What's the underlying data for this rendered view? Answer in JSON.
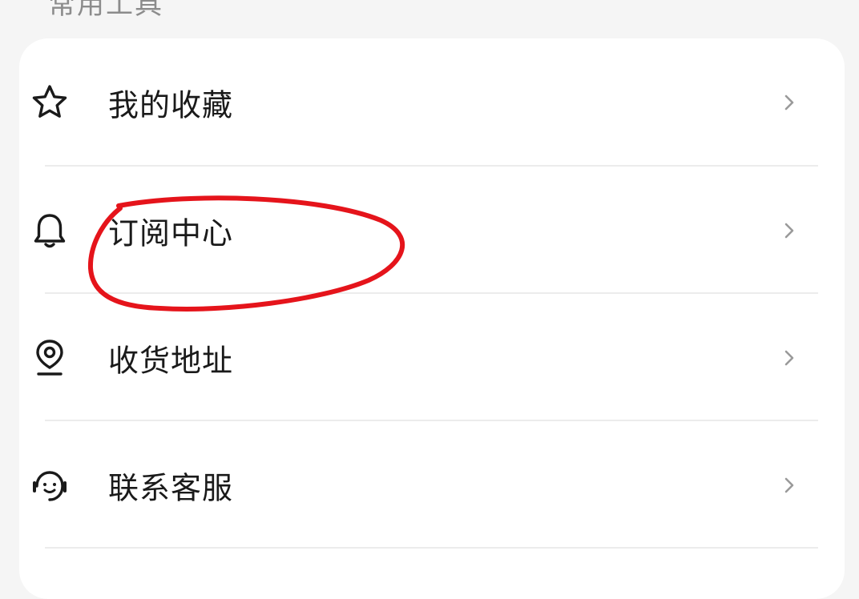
{
  "section": {
    "title": "常用工具"
  },
  "menu": {
    "items": [
      {
        "label": "我的收藏",
        "icon": "star-icon"
      },
      {
        "label": "订阅中心",
        "icon": "bell-icon"
      },
      {
        "label": "收货地址",
        "icon": "location-pin-icon"
      },
      {
        "label": "联系客服",
        "icon": "customer-service-icon"
      }
    ]
  },
  "annotation": {
    "color": "#e5141b",
    "target": "订阅中心"
  },
  "colors": {
    "background": "#f5f5f5",
    "card": "#ffffff",
    "text": "#1a1a1a",
    "chevron": "#9a9a9a"
  }
}
